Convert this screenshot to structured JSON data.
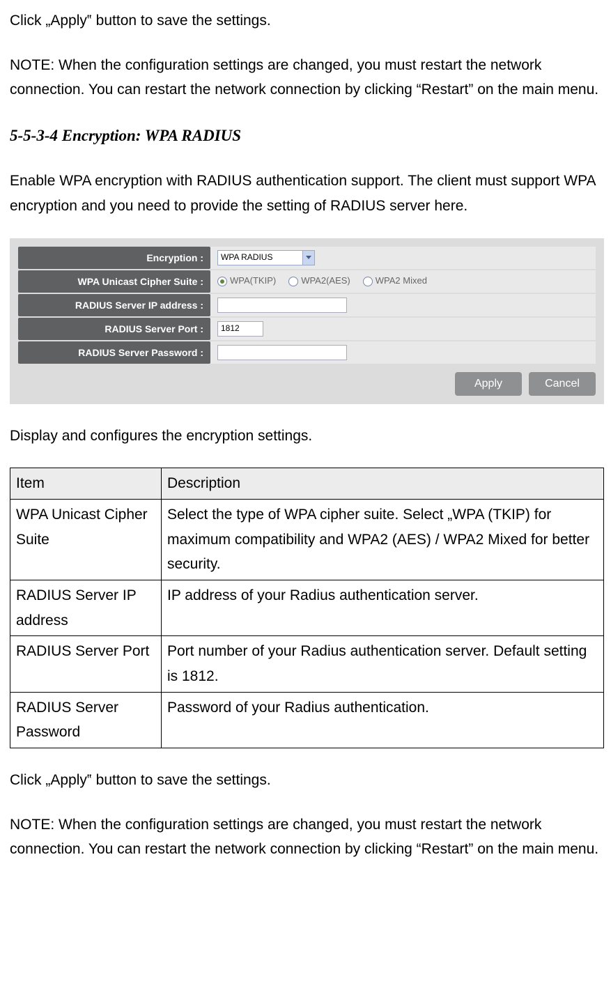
{
  "intro": {
    "apply_line": "Click „Apply‟ button to save the settings.",
    "note": "NOTE: When the configuration settings are changed, you must restart the network connection. You can restart the network connection by clicking “Restart” on the main menu."
  },
  "section_heading": "5-5-3-4 Encryption: WPA RADIUS",
  "section_intro": "Enable WPA encryption with RADIUS authentication support. The client must support WPA encryption and you need to provide the setting of RADIUS server here.",
  "form": {
    "encryption": {
      "label": "Encryption :",
      "value": "WPA RADIUS"
    },
    "cipher": {
      "label": "WPA Unicast Cipher Suite :",
      "options": [
        {
          "label": "WPA(TKIP)",
          "checked": true
        },
        {
          "label": "WPA2(AES)",
          "checked": false
        },
        {
          "label": "WPA2 Mixed",
          "checked": false
        }
      ]
    },
    "ip": {
      "label": "RADIUS Server IP address :",
      "value": ""
    },
    "port": {
      "label": "RADIUS Server Port :",
      "value": "1812"
    },
    "pwd": {
      "label": "RADIUS Server Password :",
      "value": ""
    },
    "buttons": {
      "apply": "Apply",
      "cancel": "Cancel"
    }
  },
  "table_intro": "Display and configures the encryption settings.",
  "table": {
    "headers": {
      "item": "Item",
      "desc": "Description"
    },
    "rows": [
      {
        "item": "WPA Unicast Cipher Suite",
        "desc": "Select the type of WPA cipher suite. Select „WPA (TKIP) for maximum compatibility and WPA2 (AES) / WPA2 Mixed for better security."
      },
      {
        "item": "RADIUS Server IP address",
        "desc": "IP address of your Radius authentication server."
      },
      {
        "item": "RADIUS Server Port",
        "desc": "Port number of your Radius authentication server. Default setting is 1812."
      },
      {
        "item": "RADIUS Server Password",
        "desc": "Password of your Radius authentication."
      }
    ]
  },
  "outro": {
    "apply_line": "Click „Apply‟ button to save the settings.",
    "note": "NOTE: When the configuration settings are changed, you must restart the network connection. You can restart the network connection by clicking “Restart” on the main menu."
  }
}
